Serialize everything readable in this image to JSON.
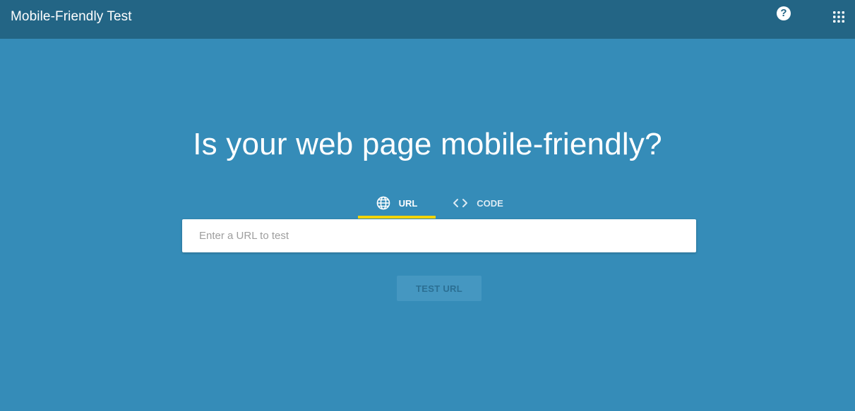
{
  "header": {
    "title": "Mobile-Friendly Test",
    "help_icon": "help-icon",
    "apps_icon": "apps-grid-icon",
    "help_glyph": "?"
  },
  "main": {
    "heading": "Is your web page mobile-friendly?",
    "tabs": [
      {
        "label": "URL",
        "icon": "globe-icon",
        "selected": true
      },
      {
        "label": "CODE",
        "icon": "code-icon",
        "selected": false
      }
    ],
    "url_input": {
      "value": "",
      "placeholder": "Enter a URL to test"
    },
    "test_button_label": "TEST URL",
    "test_button_disabled": true
  },
  "colors": {
    "background": "#358cb8",
    "header": "#236585",
    "tab_indicator": "#f4d400",
    "button_disabled": "#4597c1"
  }
}
